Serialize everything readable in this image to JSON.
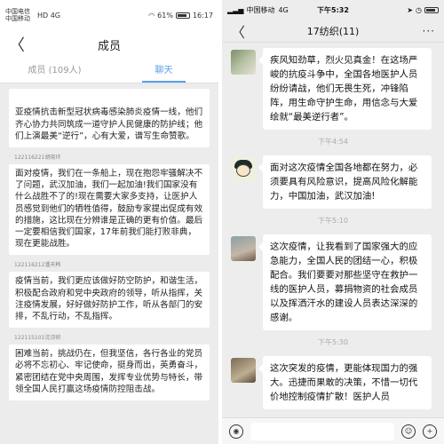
{
  "left": {
    "status": {
      "carrier_top": "中国电信",
      "carrier_bottom": "中国移动",
      "net": "HD 4G",
      "battery": "61%",
      "time": "16:17"
    },
    "header": {
      "back": "〈",
      "title": "成员"
    },
    "tabs": [
      {
        "label": "成员 (109人)"
      },
      {
        "label": "聊天"
      }
    ],
    "cards": [
      {
        "text": "亚疫情抗击新型冠状病毒感染肺炎疫情一线，他们齐心协力共同筑成一道守护人民健康的防护线；他们上演最美“逆行”，心有大爱，谱写生命赞歌。"
      },
      {
        "id": "122116221胡晓环",
        "text": "面对疫情，我们在一条船上，现在抱怨牢骚解决不了问题，武汉加油，我们一起加油!我们国家没有什么战胜不了的!现在需要大家多支持，让医护人员感觉到他们的牺牲值得，鼓励专家提出促成有效的措施，这比现在分辨谁是正确的更有价值。最后一定要相信我们国家，17年前我们能打败非典，现在更能战胜。"
      },
      {
        "id": "122116212潘天韩",
        "text": "疫情当前，我们更应该做好防空防护，和谐生活，积极配合政府和党中央政府的领导，听从指挥，关注疫情发展，好好做好防护工作，听从各部门的安排，不乱行动，不乱指挥。"
      },
      {
        "id": "122115101沈诗研",
        "text": "困难当前，挑战仍在，但我坚信，各行各业的党员必将不忘初心、牢记使命，挺身而出，英勇奋斗，紧密团结在党中央周围，发挥专业优势与特长，带领全国人民打赢这场疫情防控阻击战。"
      }
    ]
  },
  "right": {
    "status": {
      "carrier": "中国移动",
      "net": "4G",
      "time": "下午5:32"
    },
    "header": {
      "back": "〈",
      "title": "17纺织(11)",
      "more": "···"
    },
    "messages": [
      {
        "text": "疾风知劲草，烈火见真金！在这场严峻的抗疫斗争中，全国各地医护人员纷纷请战，他们无畏生死，冲锋陷阵，用生命守护生命，用信念与大爱绘就“最美逆行者”。"
      },
      {
        "time": "下午4:54",
        "text": "面对这次疫情全国各地都在努力，必须要具有风险意识，提高风险化解能力，中国加油，武汉加油!"
      },
      {
        "time": "下午5:10",
        "text": "这次疫情，让我看到了国家强大的应急能力，全国人民的团结一心，积极配合。我们要要对那些坚守在救护一线的医护人员，募捐物资的社会成员以及挥洒汗水的建设人员表达深深的感谢。"
      },
      {
        "time": "下午5:30",
        "text": "这次突发的疫情，更能体现国力的强大。迅捷而果敢的决策，不惜一切代价地控制疫情扩散！医护人员"
      }
    ]
  }
}
